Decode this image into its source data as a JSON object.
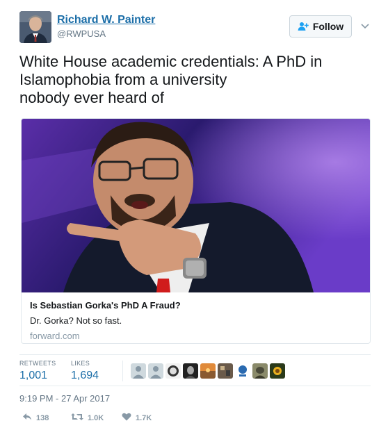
{
  "author": {
    "display_name": "Richard W. Painter",
    "handle": "@RWPUSA"
  },
  "follow_button": {
    "label": "Follow"
  },
  "tweet": {
    "lines": [
      "White House academic credentials: A PhD in",
      "Islamophobia from a university",
      "nobody ever heard of"
    ]
  },
  "card": {
    "title": "Is Sebastian Gorka's PhD A Fraud?",
    "description": "Dr. Gorka? Not so fast.",
    "domain": "forward.com"
  },
  "stats": {
    "retweets_label": "RETWEETS",
    "retweets_value": "1,001",
    "likes_label": "LIKES",
    "likes_value": "1,694"
  },
  "timestamp": "9:19 PM - 27 Apr 2017",
  "actions": {
    "reply_count": "138",
    "retweet_count": "1.0K",
    "like_count": "1.7K"
  },
  "colors": {
    "link_blue": "#1b6ea8",
    "muted_gray": "#657786",
    "action_gray": "#8899a6"
  }
}
